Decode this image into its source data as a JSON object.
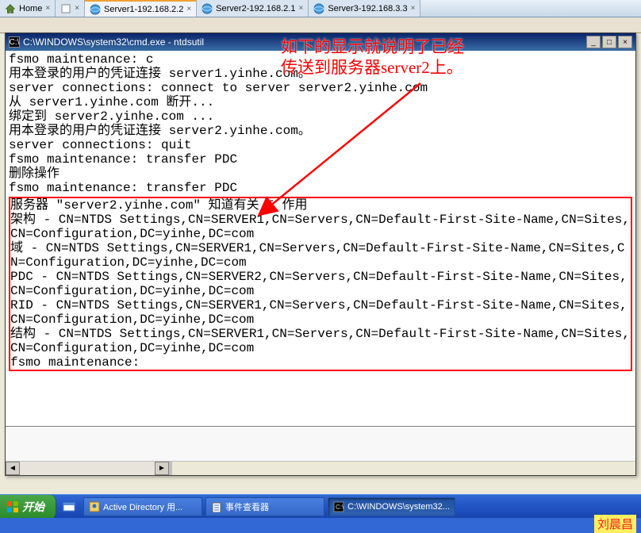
{
  "browser": {
    "tabs": [
      {
        "label": "Home",
        "icon": "home"
      },
      {
        "label": "",
        "icon": "blank"
      },
      {
        "label": "Server1-192.168.2.2",
        "icon": "sphere",
        "active": true
      },
      {
        "label": "Server2-192.168.2.1",
        "icon": "sphere"
      },
      {
        "label": "Server3-192.168.3.3",
        "icon": "sphere"
      }
    ]
  },
  "cmd": {
    "title": "C:\\WINDOWS\\system32\\cmd.exe - ntdsutil",
    "lines": [
      "fsmo maintenance: c",
      "用本登录的用户的凭证连接 server1.yinhe.com。",
      "server connections: connect to server server2.yinhe.com",
      "从 server1.yinhe.com 断开...",
      "绑定到 server2.yinhe.com ...",
      "用本登录的用户的凭证连接 server2.yinhe.com。",
      "server connections: quit",
      "fsmo maintenance: transfer PDC",
      "删除操作",
      "fsmo maintenance: transfer PDC"
    ],
    "roles_block": [
      "服务器 \"server2.yinhe.com\" 知道有关 5 作用",
      "架构 - CN=NTDS Settings,CN=SERVER1,CN=Servers,CN=Default-First-Site-Name,CN=Sites,CN=Configuration,DC=yinhe,DC=com",
      "域 - CN=NTDS Settings,CN=SERVER1,CN=Servers,CN=Default-First-Site-Name,CN=Sites,CN=Configuration,DC=yinhe,DC=com",
      "PDC - CN=NTDS Settings,CN=SERVER2,CN=Servers,CN=Default-First-Site-Name,CN=Sites,CN=Configuration,DC=yinhe,DC=com",
      "RID - CN=NTDS Settings,CN=SERVER1,CN=Servers,CN=Default-First-Site-Name,CN=Sites,CN=Configuration,DC=yinhe,DC=com",
      "结构 - CN=NTDS Settings,CN=SERVER1,CN=Servers,CN=Default-First-Site-Name,CN=Sites,CN=Configuration,DC=yinhe,DC=com",
      "fsmo maintenance:"
    ]
  },
  "annotation": {
    "line1": "如下的显示就说明了已经",
    "line2": "传送到服务器server2上。"
  },
  "taskbar": {
    "start": "开始",
    "tasks": [
      {
        "label": "Active Directory 用...",
        "active": false,
        "icon": "adtool"
      },
      {
        "label": "事件查看器",
        "active": false,
        "icon": "eventvwr"
      },
      {
        "label": "C:\\WINDOWS\\system32...",
        "active": true,
        "icon": "cmd"
      }
    ]
  },
  "watermark": "刘晨昌"
}
